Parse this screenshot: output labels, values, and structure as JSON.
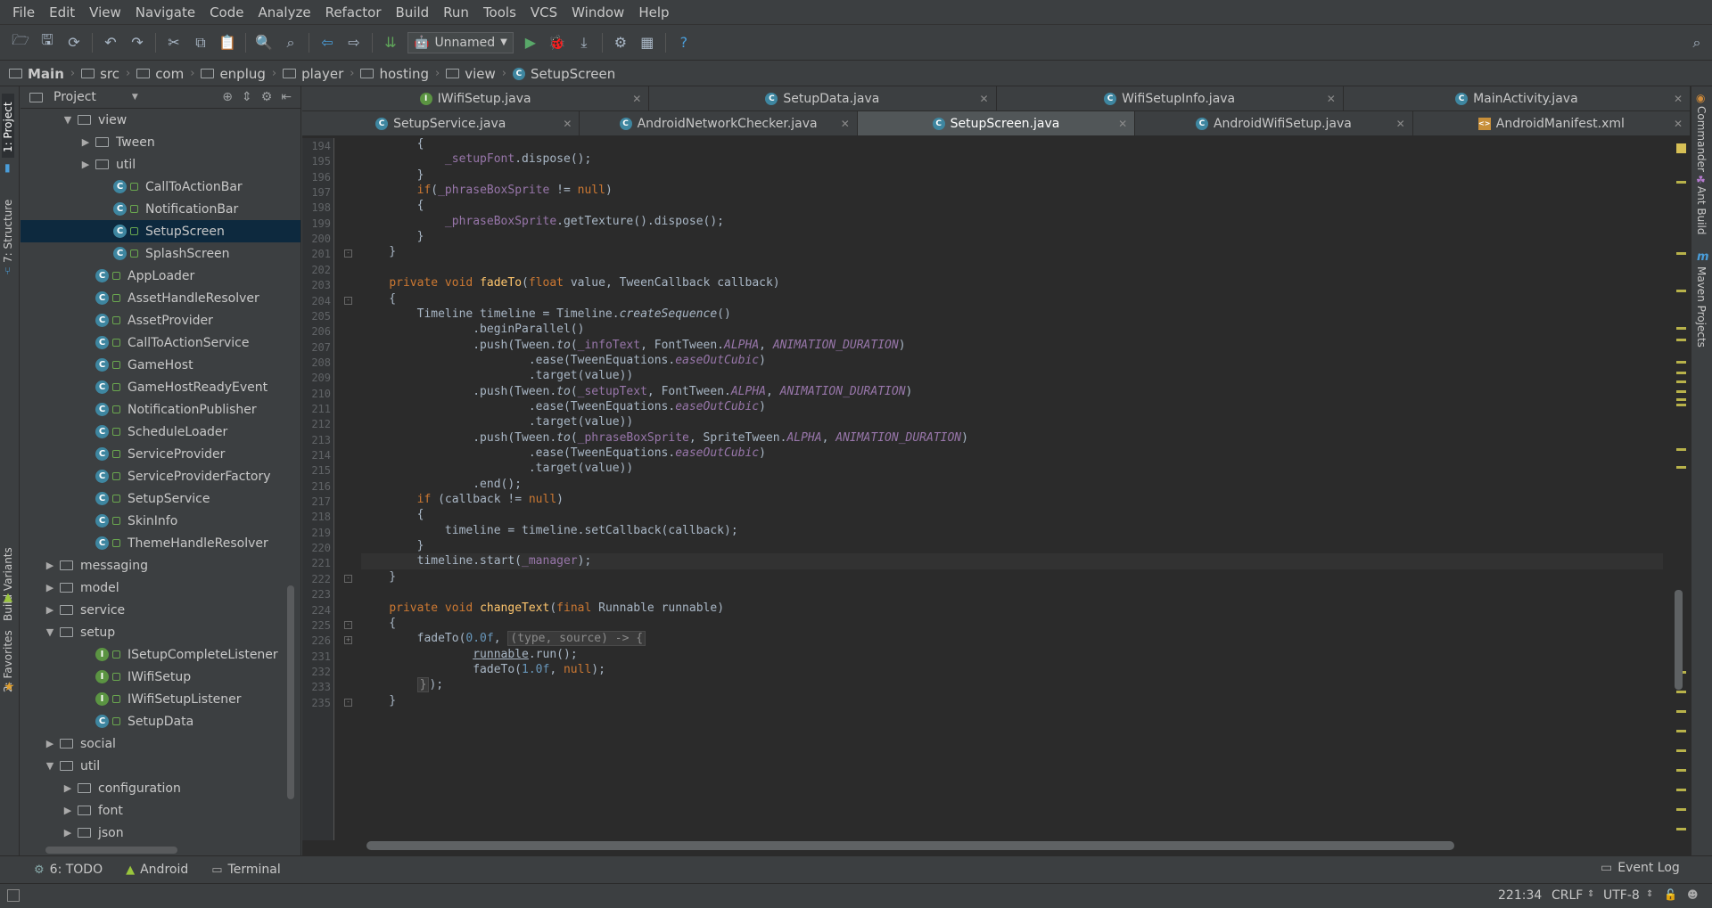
{
  "menu": [
    "File",
    "Edit",
    "View",
    "Navigate",
    "Code",
    "Analyze",
    "Refactor",
    "Build",
    "Run",
    "Tools",
    "VCS",
    "Window",
    "Help"
  ],
  "toolbar": {
    "run_config": "Unnamed",
    "help_symbol": "?"
  },
  "breadcrumbs": [
    "Main",
    "src",
    "com",
    "enplug",
    "player",
    "hosting",
    "view",
    "SetupScreen"
  ],
  "left_tool_tabs": {
    "project": "1: Project",
    "structure": "7: Structure",
    "build_variants": "Build Variants",
    "favorites": "2: Favorites"
  },
  "right_tool_tabs": {
    "commander": "Commander",
    "ant_build": "Ant Build",
    "maven": "Maven Projects"
  },
  "project_panel": {
    "title": "Project"
  },
  "tree": [
    {
      "label": "view",
      "kind": "folder",
      "indent": 2,
      "expanded": true
    },
    {
      "label": "Tween",
      "kind": "folder",
      "indent": 3,
      "expanded": false
    },
    {
      "label": "util",
      "kind": "folder",
      "indent": 3,
      "expanded": false
    },
    {
      "label": "CallToActionBar",
      "kind": "class",
      "indent": 4
    },
    {
      "label": "NotificationBar",
      "kind": "class",
      "indent": 4
    },
    {
      "label": "SetupScreen",
      "kind": "class",
      "indent": 4,
      "selected": true
    },
    {
      "label": "SplashScreen",
      "kind": "class",
      "indent": 4
    },
    {
      "label": "AppLoader",
      "kind": "class",
      "indent": 3
    },
    {
      "label": "AssetHandleResolver",
      "kind": "class",
      "indent": 3
    },
    {
      "label": "AssetProvider",
      "kind": "class",
      "indent": 3
    },
    {
      "label": "CallToActionService",
      "kind": "class",
      "indent": 3
    },
    {
      "label": "GameHost",
      "kind": "class",
      "indent": 3
    },
    {
      "label": "GameHostReadyEvent",
      "kind": "class",
      "indent": 3
    },
    {
      "label": "NotificationPublisher",
      "kind": "class",
      "indent": 3
    },
    {
      "label": "ScheduleLoader",
      "kind": "class",
      "indent": 3
    },
    {
      "label": "ServiceProvider",
      "kind": "class",
      "indent": 3
    },
    {
      "label": "ServiceProviderFactory",
      "kind": "class",
      "indent": 3
    },
    {
      "label": "SetupService",
      "kind": "class",
      "indent": 3
    },
    {
      "label": "SkinInfo",
      "kind": "class",
      "indent": 3
    },
    {
      "label": "ThemeHandleResolver",
      "kind": "class",
      "indent": 3
    },
    {
      "label": "messaging",
      "kind": "folder",
      "indent": 1,
      "expanded": false
    },
    {
      "label": "model",
      "kind": "folder",
      "indent": 1,
      "expanded": false
    },
    {
      "label": "service",
      "kind": "folder",
      "indent": 1,
      "expanded": false
    },
    {
      "label": "setup",
      "kind": "folder",
      "indent": 1,
      "expanded": true
    },
    {
      "label": "ISetupCompleteListener",
      "kind": "interface",
      "indent": 3
    },
    {
      "label": "IWifiSetup",
      "kind": "interface",
      "indent": 3
    },
    {
      "label": "IWifiSetupListener",
      "kind": "interface",
      "indent": 3
    },
    {
      "label": "SetupData",
      "kind": "class",
      "indent": 3
    },
    {
      "label": "social",
      "kind": "folder",
      "indent": 1,
      "expanded": false
    },
    {
      "label": "util",
      "kind": "folder",
      "indent": 1,
      "expanded": true
    },
    {
      "label": "configuration",
      "kind": "folder",
      "indent": 2,
      "expanded": false
    },
    {
      "label": "font",
      "kind": "folder",
      "indent": 2,
      "expanded": false
    },
    {
      "label": "json",
      "kind": "folder",
      "indent": 2,
      "expanded": false
    }
  ],
  "tabs_row1": [
    {
      "label": "IWifiSetup.java",
      "icon": "I"
    },
    {
      "label": "SetupData.java",
      "icon": "C"
    },
    {
      "label": "WifiSetupInfo.java",
      "icon": "C"
    },
    {
      "label": "MainActivity.java",
      "icon": "C"
    }
  ],
  "tabs_row2": [
    {
      "label": "SetupService.java",
      "icon": "C"
    },
    {
      "label": "AndroidNetworkChecker.java",
      "icon": "C"
    },
    {
      "label": "SetupScreen.java",
      "icon": "C",
      "active": true
    },
    {
      "label": "AndroidWifiSetup.java",
      "icon": "C"
    },
    {
      "label": "AndroidManifest.xml",
      "icon": "X"
    }
  ],
  "code_lines": [
    {
      "n": "194",
      "code": [
        [
          "",
          "        {"
        ]
      ]
    },
    {
      "n": "195",
      "code": [
        [
          "",
          "            "
        ],
        [
          "fld",
          "_setupFont"
        ],
        [
          "",
          ".dispose();"
        ]
      ]
    },
    {
      "n": "196",
      "code": [
        [
          "",
          "        }"
        ]
      ]
    },
    {
      "n": "197",
      "code": [
        [
          "",
          "        "
        ],
        [
          "kw",
          "if"
        ],
        [
          "",
          "("
        ],
        [
          "fld",
          "_phraseBoxSprite"
        ],
        [
          "",
          " != "
        ],
        [
          "kw",
          "null"
        ],
        [
          "",
          ")"
        ]
      ]
    },
    {
      "n": "198",
      "code": [
        [
          "",
          "        {"
        ]
      ]
    },
    {
      "n": "199",
      "code": [
        [
          "",
          "            "
        ],
        [
          "fld",
          "_phraseBoxSprite"
        ],
        [
          "",
          ".getTexture().dispose();"
        ]
      ]
    },
    {
      "n": "200",
      "code": [
        [
          "",
          "        }"
        ]
      ]
    },
    {
      "n": "201",
      "code": [
        [
          "",
          "    }"
        ]
      ],
      "fold": "-"
    },
    {
      "n": "202",
      "code": []
    },
    {
      "n": "203",
      "code": [
        [
          "",
          "    "
        ],
        [
          "kw",
          "private void "
        ],
        [
          "fn",
          "fadeTo"
        ],
        [
          "",
          "("
        ],
        [
          "kw",
          "float "
        ],
        [
          "",
          "value, TweenCallback callback)"
        ]
      ]
    },
    {
      "n": "204",
      "code": [
        [
          "",
          "    {"
        ]
      ],
      "fold": "-"
    },
    {
      "n": "205",
      "code": [
        [
          "",
          "        Timeline timeline = Timeline."
        ],
        [
          "ital",
          "createSequence"
        ],
        [
          "",
          "()"
        ]
      ]
    },
    {
      "n": "206",
      "code": [
        [
          "",
          "                .beginParallel()"
        ]
      ]
    },
    {
      "n": "207",
      "code": [
        [
          "",
          "                .push(Tween."
        ],
        [
          "ital",
          "to"
        ],
        [
          "",
          "("
        ],
        [
          "fld",
          "_infoText"
        ],
        [
          "",
          ", FontTween."
        ],
        [
          "st",
          "ALPHA"
        ],
        [
          "",
          ", "
        ],
        [
          "st",
          "ANIMATION_DURATION"
        ],
        [
          "",
          ")"
        ]
      ]
    },
    {
      "n": "208",
      "code": [
        [
          "",
          "                        .ease(TweenEquations."
        ],
        [
          "st",
          "easeOutCubic"
        ],
        [
          "",
          ")"
        ]
      ]
    },
    {
      "n": "209",
      "code": [
        [
          "",
          "                        .target(value))"
        ]
      ]
    },
    {
      "n": "210",
      "code": [
        [
          "",
          "                .push(Tween."
        ],
        [
          "ital",
          "to"
        ],
        [
          "",
          "("
        ],
        [
          "fld",
          "_setupText"
        ],
        [
          "",
          ", FontTween."
        ],
        [
          "st",
          "ALPHA"
        ],
        [
          "",
          ", "
        ],
        [
          "st",
          "ANIMATION_DURATION"
        ],
        [
          "",
          ")"
        ]
      ]
    },
    {
      "n": "211",
      "code": [
        [
          "",
          "                        .ease(TweenEquations."
        ],
        [
          "st",
          "easeOutCubic"
        ],
        [
          "",
          ")"
        ]
      ]
    },
    {
      "n": "212",
      "code": [
        [
          "",
          "                        .target(value))"
        ]
      ]
    },
    {
      "n": "213",
      "code": [
        [
          "",
          "                .push(Tween."
        ],
        [
          "ital",
          "to"
        ],
        [
          "",
          "("
        ],
        [
          "fld",
          "_phraseBoxSprite"
        ],
        [
          "",
          ", SpriteTween."
        ],
        [
          "st",
          "ALPHA"
        ],
        [
          "",
          ", "
        ],
        [
          "st",
          "ANIMATION_DURATION"
        ],
        [
          "",
          ")"
        ]
      ]
    },
    {
      "n": "214",
      "code": [
        [
          "",
          "                        .ease(TweenEquations."
        ],
        [
          "st",
          "easeOutCubic"
        ],
        [
          "",
          ")"
        ]
      ]
    },
    {
      "n": "215",
      "code": [
        [
          "",
          "                        .target(value))"
        ]
      ]
    },
    {
      "n": "216",
      "code": [
        [
          "",
          "                .end();"
        ]
      ]
    },
    {
      "n": "217",
      "code": [
        [
          "",
          "        "
        ],
        [
          "kw",
          "if "
        ],
        [
          "",
          "(callback != "
        ],
        [
          "kw",
          "null"
        ],
        [
          "",
          ")"
        ]
      ]
    },
    {
      "n": "218",
      "code": [
        [
          "",
          "        {"
        ]
      ]
    },
    {
      "n": "219",
      "code": [
        [
          "",
          "            timeline = timeline.setCallback(callback);"
        ]
      ]
    },
    {
      "n": "220",
      "code": [
        [
          "",
          "        }"
        ]
      ]
    },
    {
      "n": "221",
      "code": [
        [
          "",
          "        timeline.start("
        ],
        [
          "fld",
          "_manager"
        ],
        [
          "",
          ");"
        ]
      ],
      "caret": true
    },
    {
      "n": "222",
      "code": [
        [
          "",
          "    }"
        ]
      ],
      "fold": "-"
    },
    {
      "n": "223",
      "code": []
    },
    {
      "n": "224",
      "code": [
        [
          "",
          "    "
        ],
        [
          "kw",
          "private void "
        ],
        [
          "fn",
          "changeText"
        ],
        [
          "",
          "("
        ],
        [
          "kw",
          "final "
        ],
        [
          "",
          "Runnable runnable)"
        ]
      ]
    },
    {
      "n": "225",
      "code": [
        [
          "",
          "    {"
        ]
      ],
      "fold": "-"
    },
    {
      "n": "226",
      "code": [
        [
          "",
          "        fadeTo("
        ],
        [
          "num",
          "0.0f"
        ],
        [
          "",
          ", "
        ],
        [
          "fold-inline",
          "(type, source) -> {"
        ]
      ],
      "fold": "+"
    },
    {
      "n": "231",
      "code": [
        [
          "",
          "                "
        ],
        [
          "ul",
          "runnable"
        ],
        [
          "",
          ".run();"
        ]
      ]
    },
    {
      "n": "232",
      "code": [
        [
          "",
          "                fadeTo("
        ],
        [
          "num",
          "1.0f"
        ],
        [
          "",
          ", "
        ],
        [
          "kw",
          "null"
        ],
        [
          "",
          ");"
        ]
      ]
    },
    {
      "n": "233",
      "code": [
        [
          "",
          "        "
        ],
        [
          "fold-inline",
          "}"
        ],
        [
          "",
          ");"
        ]
      ]
    },
    {
      "n": "235",
      "code": [
        [
          "",
          "    }"
        ]
      ],
      "fold": "-"
    }
  ],
  "bottom_tools": [
    {
      "label": "6: TODO",
      "icon": "todo-icon"
    },
    {
      "label": "Android",
      "icon": "android-icon"
    },
    {
      "label": "Terminal",
      "icon": "terminal-icon"
    }
  ],
  "event_log": "Event Log",
  "status": {
    "position": "221:34",
    "line_sep": "CRLF",
    "encoding": "UTF-8"
  },
  "colors": {
    "keyword": "#cc7832",
    "field": "#9876aa",
    "method": "#ffc66d",
    "number": "#6897bb",
    "selection": "#0d293e"
  }
}
